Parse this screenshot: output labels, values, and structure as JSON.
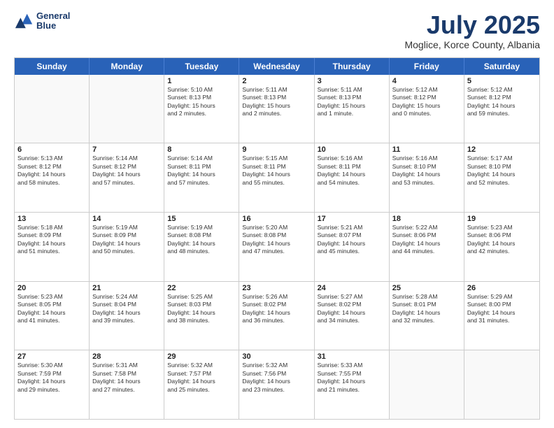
{
  "header": {
    "logo_line1": "General",
    "logo_line2": "Blue",
    "main_title": "July 2025",
    "subtitle": "Moglice, Korce County, Albania"
  },
  "weekdays": [
    "Sunday",
    "Monday",
    "Tuesday",
    "Wednesday",
    "Thursday",
    "Friday",
    "Saturday"
  ],
  "rows": [
    [
      {
        "day": "",
        "lines": [],
        "empty": true
      },
      {
        "day": "",
        "lines": [],
        "empty": true
      },
      {
        "day": "1",
        "lines": [
          "Sunrise: 5:10 AM",
          "Sunset: 8:13 PM",
          "Daylight: 15 hours",
          "and 2 minutes."
        ]
      },
      {
        "day": "2",
        "lines": [
          "Sunrise: 5:11 AM",
          "Sunset: 8:13 PM",
          "Daylight: 15 hours",
          "and 2 minutes."
        ]
      },
      {
        "day": "3",
        "lines": [
          "Sunrise: 5:11 AM",
          "Sunset: 8:13 PM",
          "Daylight: 15 hours",
          "and 1 minute."
        ]
      },
      {
        "day": "4",
        "lines": [
          "Sunrise: 5:12 AM",
          "Sunset: 8:12 PM",
          "Daylight: 15 hours",
          "and 0 minutes."
        ]
      },
      {
        "day": "5",
        "lines": [
          "Sunrise: 5:12 AM",
          "Sunset: 8:12 PM",
          "Daylight: 14 hours",
          "and 59 minutes."
        ]
      }
    ],
    [
      {
        "day": "6",
        "lines": [
          "Sunrise: 5:13 AM",
          "Sunset: 8:12 PM",
          "Daylight: 14 hours",
          "and 58 minutes."
        ]
      },
      {
        "day": "7",
        "lines": [
          "Sunrise: 5:14 AM",
          "Sunset: 8:12 PM",
          "Daylight: 14 hours",
          "and 57 minutes."
        ]
      },
      {
        "day": "8",
        "lines": [
          "Sunrise: 5:14 AM",
          "Sunset: 8:11 PM",
          "Daylight: 14 hours",
          "and 57 minutes."
        ]
      },
      {
        "day": "9",
        "lines": [
          "Sunrise: 5:15 AM",
          "Sunset: 8:11 PM",
          "Daylight: 14 hours",
          "and 55 minutes."
        ]
      },
      {
        "day": "10",
        "lines": [
          "Sunrise: 5:16 AM",
          "Sunset: 8:11 PM",
          "Daylight: 14 hours",
          "and 54 minutes."
        ]
      },
      {
        "day": "11",
        "lines": [
          "Sunrise: 5:16 AM",
          "Sunset: 8:10 PM",
          "Daylight: 14 hours",
          "and 53 minutes."
        ]
      },
      {
        "day": "12",
        "lines": [
          "Sunrise: 5:17 AM",
          "Sunset: 8:10 PM",
          "Daylight: 14 hours",
          "and 52 minutes."
        ]
      }
    ],
    [
      {
        "day": "13",
        "lines": [
          "Sunrise: 5:18 AM",
          "Sunset: 8:09 PM",
          "Daylight: 14 hours",
          "and 51 minutes."
        ]
      },
      {
        "day": "14",
        "lines": [
          "Sunrise: 5:19 AM",
          "Sunset: 8:09 PM",
          "Daylight: 14 hours",
          "and 50 minutes."
        ]
      },
      {
        "day": "15",
        "lines": [
          "Sunrise: 5:19 AM",
          "Sunset: 8:08 PM",
          "Daylight: 14 hours",
          "and 48 minutes."
        ]
      },
      {
        "day": "16",
        "lines": [
          "Sunrise: 5:20 AM",
          "Sunset: 8:08 PM",
          "Daylight: 14 hours",
          "and 47 minutes."
        ]
      },
      {
        "day": "17",
        "lines": [
          "Sunrise: 5:21 AM",
          "Sunset: 8:07 PM",
          "Daylight: 14 hours",
          "and 45 minutes."
        ]
      },
      {
        "day": "18",
        "lines": [
          "Sunrise: 5:22 AM",
          "Sunset: 8:06 PM",
          "Daylight: 14 hours",
          "and 44 minutes."
        ]
      },
      {
        "day": "19",
        "lines": [
          "Sunrise: 5:23 AM",
          "Sunset: 8:06 PM",
          "Daylight: 14 hours",
          "and 42 minutes."
        ]
      }
    ],
    [
      {
        "day": "20",
        "lines": [
          "Sunrise: 5:23 AM",
          "Sunset: 8:05 PM",
          "Daylight: 14 hours",
          "and 41 minutes."
        ]
      },
      {
        "day": "21",
        "lines": [
          "Sunrise: 5:24 AM",
          "Sunset: 8:04 PM",
          "Daylight: 14 hours",
          "and 39 minutes."
        ]
      },
      {
        "day": "22",
        "lines": [
          "Sunrise: 5:25 AM",
          "Sunset: 8:03 PM",
          "Daylight: 14 hours",
          "and 38 minutes."
        ]
      },
      {
        "day": "23",
        "lines": [
          "Sunrise: 5:26 AM",
          "Sunset: 8:02 PM",
          "Daylight: 14 hours",
          "and 36 minutes."
        ]
      },
      {
        "day": "24",
        "lines": [
          "Sunrise: 5:27 AM",
          "Sunset: 8:02 PM",
          "Daylight: 14 hours",
          "and 34 minutes."
        ]
      },
      {
        "day": "25",
        "lines": [
          "Sunrise: 5:28 AM",
          "Sunset: 8:01 PM",
          "Daylight: 14 hours",
          "and 32 minutes."
        ]
      },
      {
        "day": "26",
        "lines": [
          "Sunrise: 5:29 AM",
          "Sunset: 8:00 PM",
          "Daylight: 14 hours",
          "and 31 minutes."
        ]
      }
    ],
    [
      {
        "day": "27",
        "lines": [
          "Sunrise: 5:30 AM",
          "Sunset: 7:59 PM",
          "Daylight: 14 hours",
          "and 29 minutes."
        ]
      },
      {
        "day": "28",
        "lines": [
          "Sunrise: 5:31 AM",
          "Sunset: 7:58 PM",
          "Daylight: 14 hours",
          "and 27 minutes."
        ]
      },
      {
        "day": "29",
        "lines": [
          "Sunrise: 5:32 AM",
          "Sunset: 7:57 PM",
          "Daylight: 14 hours",
          "and 25 minutes."
        ]
      },
      {
        "day": "30",
        "lines": [
          "Sunrise: 5:32 AM",
          "Sunset: 7:56 PM",
          "Daylight: 14 hours",
          "and 23 minutes."
        ]
      },
      {
        "day": "31",
        "lines": [
          "Sunrise: 5:33 AM",
          "Sunset: 7:55 PM",
          "Daylight: 14 hours",
          "and 21 minutes."
        ]
      },
      {
        "day": "",
        "lines": [],
        "empty": true
      },
      {
        "day": "",
        "lines": [],
        "empty": true
      }
    ]
  ]
}
